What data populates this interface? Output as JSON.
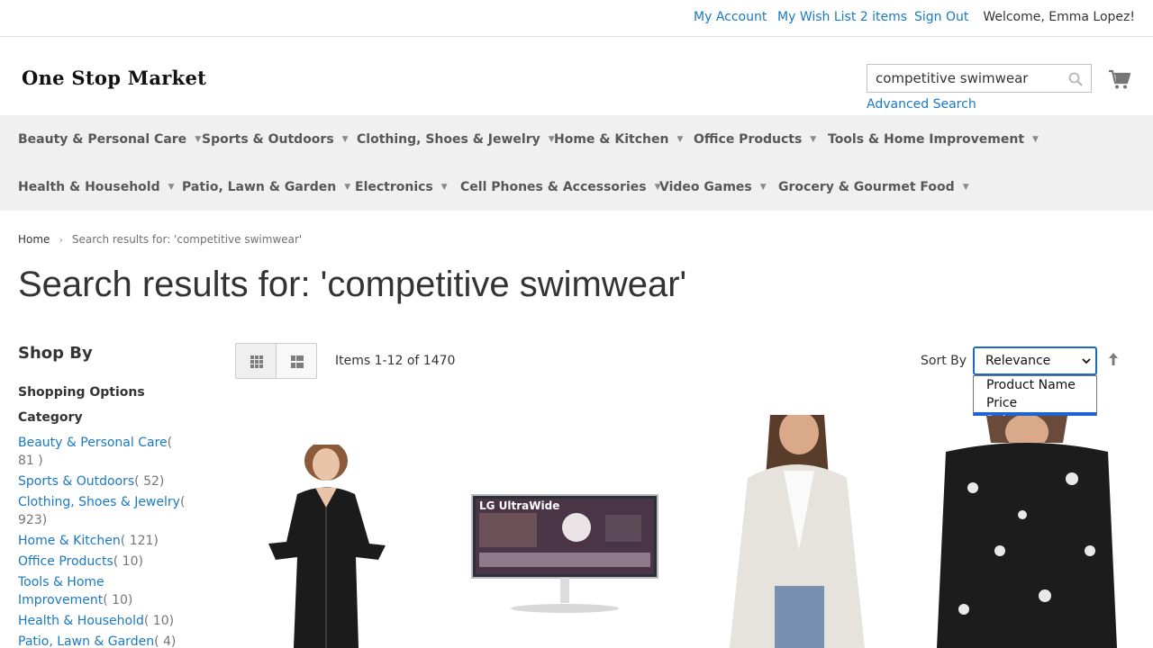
{
  "header": {
    "my_account": "My Account",
    "wish_list": "My Wish List 2 items",
    "sign_out": "Sign Out",
    "welcome": "Welcome, Emma Lopez!"
  },
  "logo": {
    "text": "One Stop Market"
  },
  "search": {
    "value": "competitive swimwear",
    "advanced": "Advanced Search"
  },
  "nav": {
    "items": [
      "Beauty & Personal Care",
      "Sports & Outdoors",
      "Clothing, Shoes & Jewelry",
      "Home & Kitchen",
      "Office Products",
      "Tools & Home Improvement",
      "Health & Household",
      "Patio, Lawn & Garden",
      "Electronics",
      "Cell Phones & Accessories",
      "Video Games",
      "Grocery & Gourmet Food"
    ]
  },
  "breadcrumb": {
    "home": "Home",
    "current": "Search results for: 'competitive swimwear'"
  },
  "page": {
    "title": "Search results for: 'competitive swimwear'"
  },
  "sidebar": {
    "shop_by": "Shop By",
    "shopping_options": "Shopping Options",
    "category_title": "Category",
    "categories": [
      {
        "name": "Beauty & Personal Care",
        "count": "( 81 )"
      },
      {
        "name": "Sports & Outdoors",
        "count": "( 52)"
      },
      {
        "name": "Clothing, Shoes & Jewelry",
        "count": "( 923)"
      },
      {
        "name": "Home & Kitchen",
        "count": "( 121)"
      },
      {
        "name": "Office Products",
        "count": "( 10)"
      },
      {
        "name": "Tools & Home Improvement",
        "count": "( 10)"
      },
      {
        "name": "Health & Household",
        "count": "( 10)"
      },
      {
        "name": "Patio, Lawn & Garden",
        "count": "( 4)"
      }
    ]
  },
  "toolbar": {
    "items_count": "Items 1-12 of 1470",
    "sort_label": "Sort By",
    "sort_selected": "Relevance",
    "sort_options": [
      "Product Name",
      "Price",
      "Relevance"
    ]
  },
  "products": [
    {
      "image": "black-leather-jacket-photo"
    },
    {
      "image": "lg-ultrawide-monitor-photo",
      "brand_text": "LG UltraWide"
    },
    {
      "image": "white-knit-cardigan-photo"
    },
    {
      "image": "black-floral-tshirt-photo"
    }
  ],
  "colors": {
    "link": "#1979c3",
    "nav_bg": "#f0f0f0",
    "select_border": "#1c6ac0",
    "option_highlight": "#1e63d1"
  }
}
